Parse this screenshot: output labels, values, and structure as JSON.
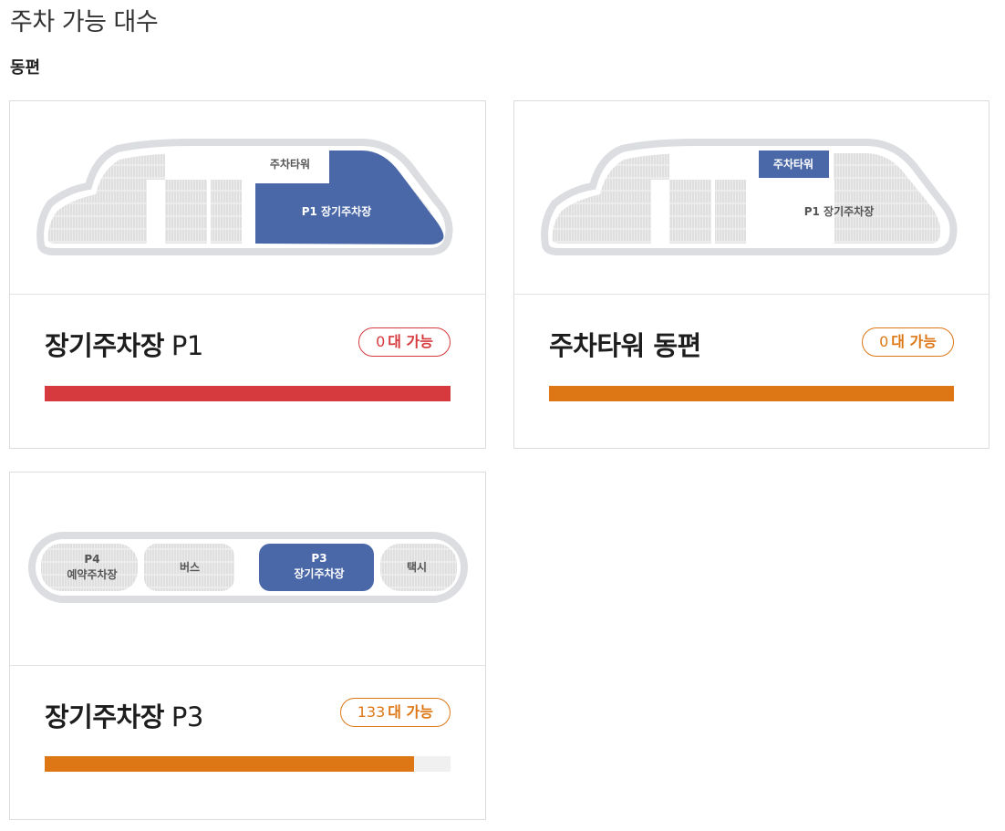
{
  "page": {
    "title": "주차 가능 대수"
  },
  "section": {
    "title": "동편"
  },
  "colors": {
    "red": "#d63a3f",
    "orange": "#dd7716",
    "blue": "#4a68a8",
    "track": "#f0f0f0"
  },
  "cards": [
    {
      "name": "장기주차장",
      "sub": "P1",
      "badge_num": "0",
      "badge_text": "대 가능",
      "status_color": "red",
      "progress": 1.0,
      "map": {
        "tower_label": "주차타워",
        "lot_label": "P1 장기주차장",
        "highlight": "lot"
      }
    },
    {
      "name": "주차타워 동편",
      "sub": "",
      "badge_num": "0",
      "badge_text": "대 가능",
      "status_color": "orange",
      "progress": 1.0,
      "map": {
        "tower_label": "주차타워",
        "lot_label": "P1 장기주차장",
        "highlight": "tower"
      }
    },
    {
      "name": "장기주차장",
      "sub": "P3",
      "badge_num": "133",
      "badge_text": "대 가능",
      "status_color": "orange",
      "progress": 0.91,
      "map": {
        "p4_line1": "P4",
        "p4_line2": "예약주차장",
        "bus": "버스",
        "p3_line1": "P3",
        "p3_line2": "장기주차장",
        "taxi": "택시"
      }
    }
  ]
}
